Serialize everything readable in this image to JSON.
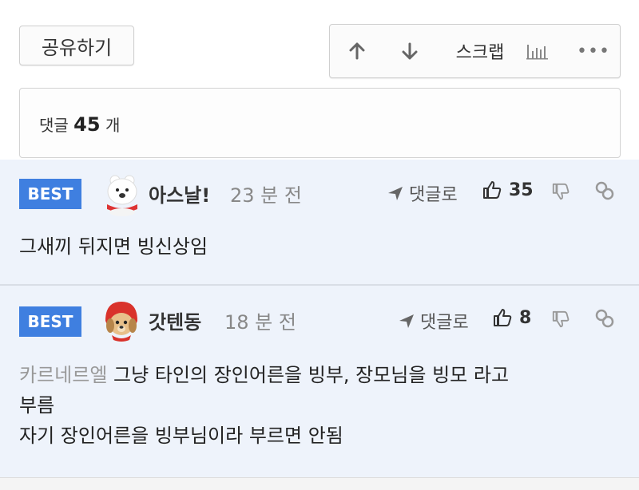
{
  "toolbar": {
    "share_label": "공유하기",
    "scrap_label": "스크랩",
    "upvote_icon": "arrow-up-icon",
    "downvote_icon": "arrow-down-icon",
    "stats_icon": "bar-chart-icon",
    "more_label": "•••"
  },
  "comment_count": {
    "prefix": "댓글",
    "count": "45",
    "suffix": "개"
  },
  "comments": [
    {
      "badge": "BEST",
      "nickname": "아스날!",
      "time": "23 분 전",
      "reply_label": "댓글로",
      "likes": "35",
      "text": "그새끼 뒤지면 빙신상임",
      "mention": "",
      "avatar_icon": "polar-bear-avatar-icon"
    },
    {
      "badge": "BEST",
      "nickname": "갓텐동",
      "time": "18 분 전",
      "reply_label": "댓글로",
      "likes": "8",
      "mention": "카르네르엘",
      "text_line1": "그냥 타인의 장인어른을 빙부, 장모님을 빙모 라고",
      "text_line2": "부름",
      "text_line3": "자기 장인어른을 빙부님이라 부르면 안됨",
      "avatar_icon": "puppy-avatar-icon"
    }
  ],
  "colors": {
    "best_badge": "#3f7fe0",
    "comment_bg": "#eef3fb"
  }
}
